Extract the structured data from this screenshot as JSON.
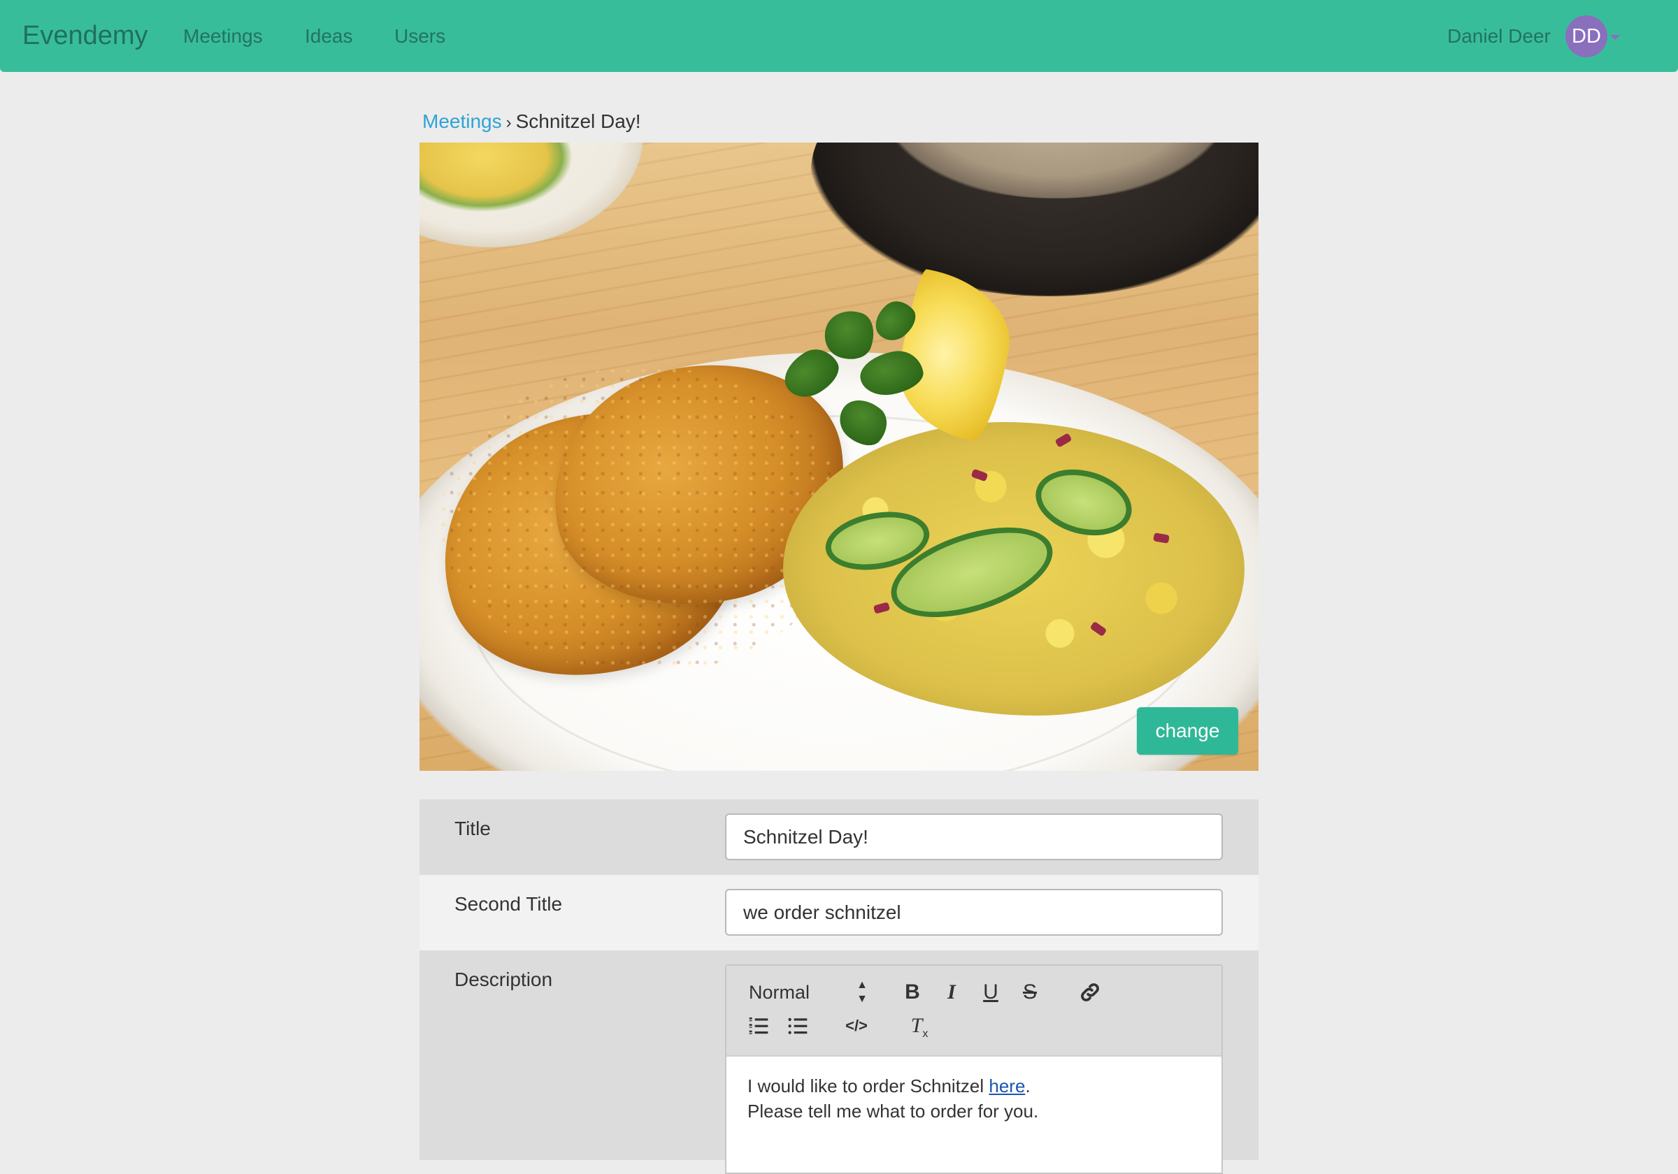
{
  "navbar": {
    "brand": "Evendemy",
    "links": [
      "Meetings",
      "Ideas",
      "Users"
    ],
    "user_name": "Daniel Deer",
    "avatar_initials": "DD",
    "colors": {
      "bar": "#38bd9b",
      "avatar": "#8a6fbd"
    }
  },
  "breadcrumb": {
    "parent": "Meetings",
    "separator": "›",
    "current": "Schnitzel Day!"
  },
  "hero": {
    "change_label": "change"
  },
  "form": {
    "title_label": "Title",
    "title_value": "Schnitzel Day!",
    "second_title_label": "Second Title",
    "second_title_value": "we order schnitzel",
    "description_label": "Description",
    "editor": {
      "format_select": "Normal",
      "content_line1_prefix": "I would like to order Schnitzel ",
      "content_link": "here",
      "content_line1_suffix": ".",
      "content_line2": "Please tell me what to order for you."
    }
  }
}
